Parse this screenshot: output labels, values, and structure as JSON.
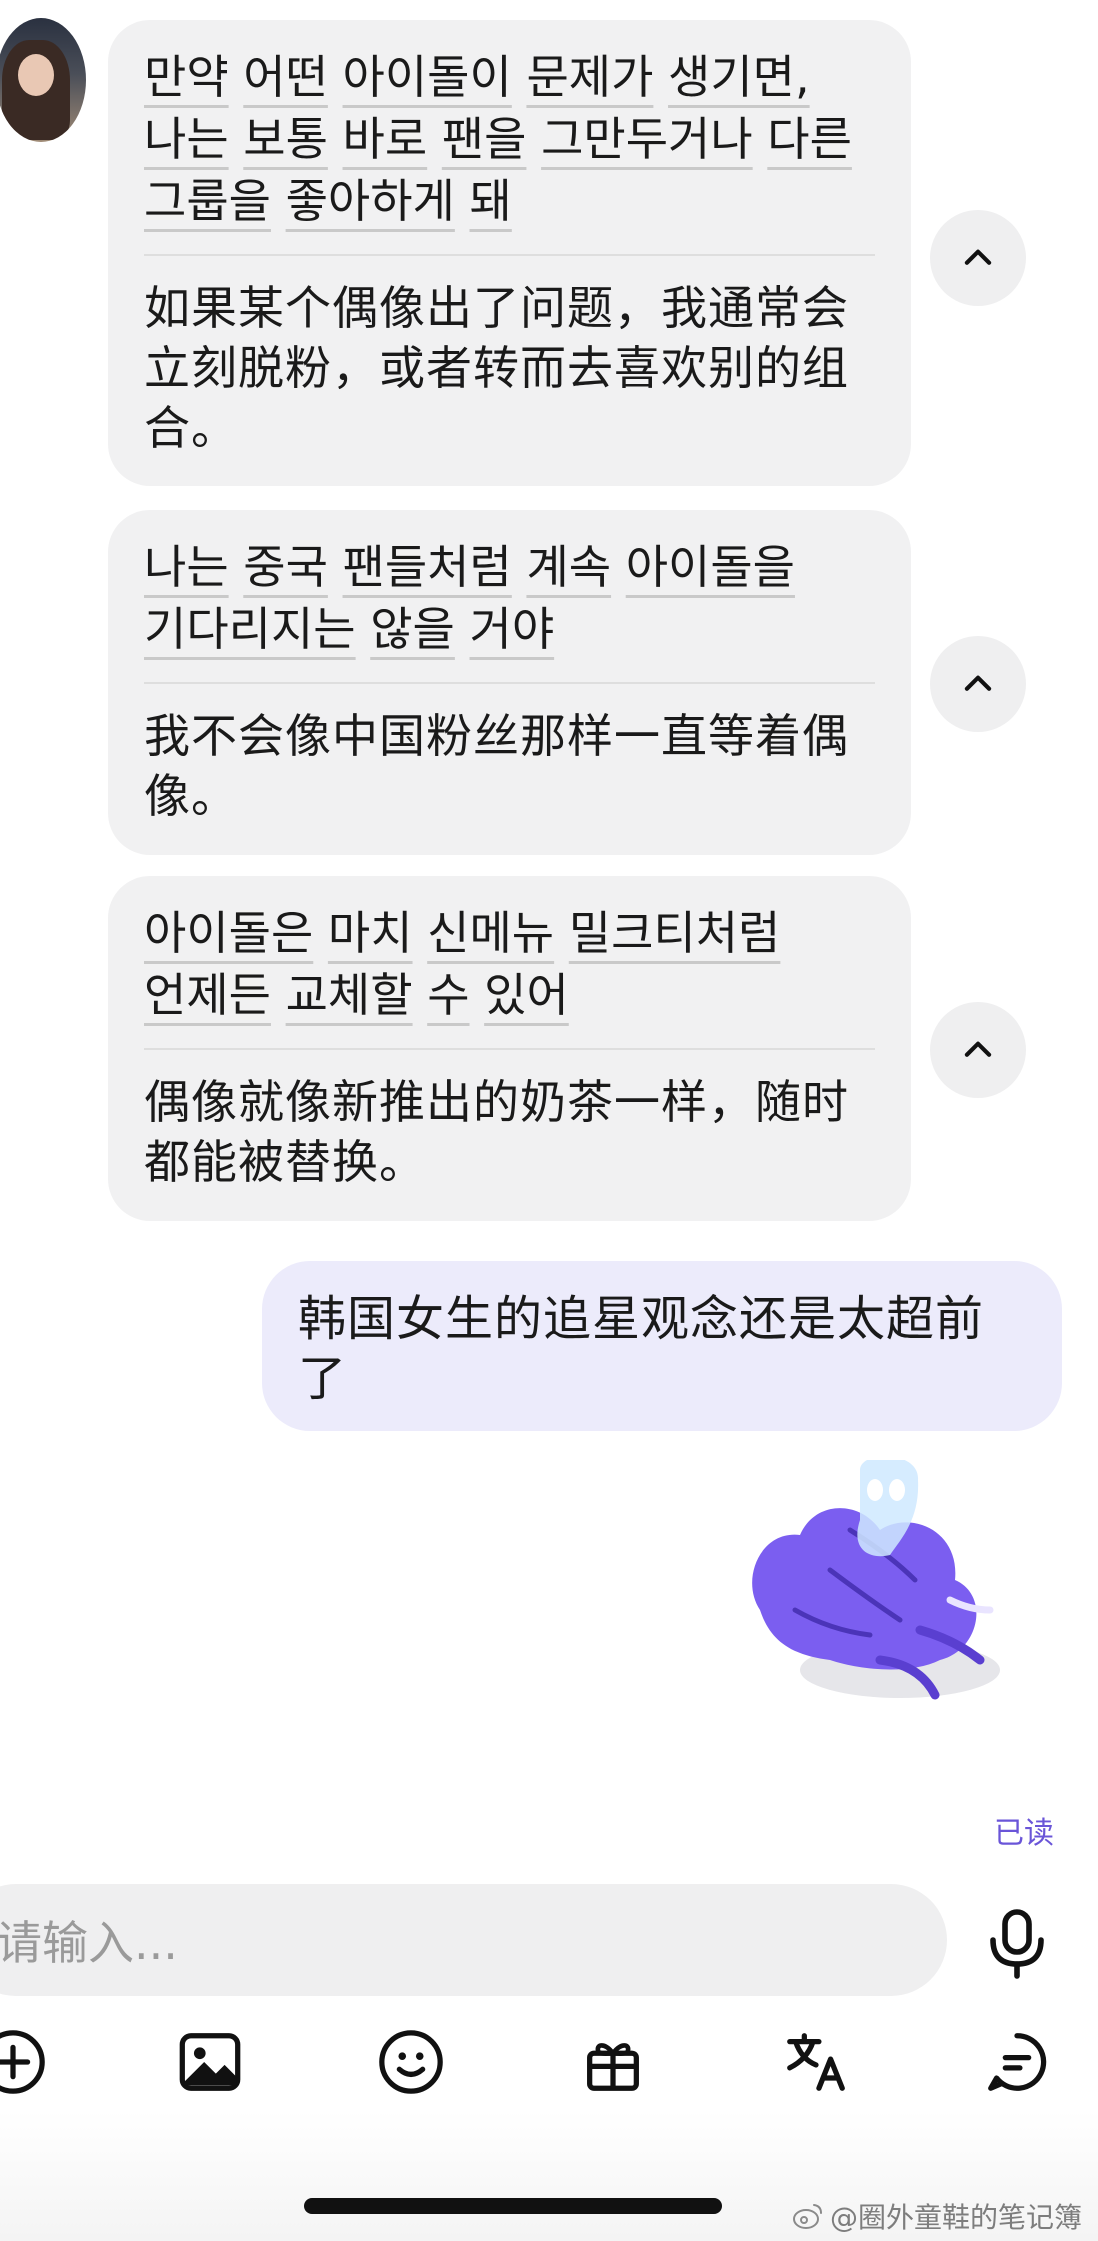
{
  "messages": [
    {
      "korean_words": [
        "만약",
        "어떤",
        "아이돌이",
        "문제가",
        "생기면,",
        "나는",
        "보통",
        "바로",
        "팬을",
        "그만두거나",
        "다른",
        "그룹을",
        "좋아하게",
        "돼"
      ],
      "chinese": "如果某个偶像出了问题，我通常会立刻脱粉，或者转而去喜欢别的组合。"
    },
    {
      "korean_words": [
        "나는",
        "중국",
        "팬들처럼",
        "계속",
        "아이돌을",
        "기다리지는",
        "않을",
        "거야"
      ],
      "chinese": "我不会像中国粉丝那样一直等着偶像。"
    },
    {
      "korean_words": [
        "아이돌은",
        "마치",
        "신메뉴",
        "밀크티처럼",
        "언제든",
        "교체할",
        "수",
        "있어"
      ],
      "chinese": "偶像就像新推出的奶茶一样，随时都能被替换。"
    }
  ],
  "my_message": "韩国女生的追星观念还是太超前了",
  "read_status": "已读",
  "input": {
    "placeholder": "请输入..."
  },
  "toolbar": [
    "plus-icon",
    "image-icon",
    "emoji-icon",
    "gift-icon",
    "translate-icon",
    "chat-icon"
  ],
  "watermark": "@圈外童鞋的笔记簿",
  "colors": {
    "bubble_bg": "#f1f1f2",
    "my_bubble_bg": "#ecebfb",
    "accent": "#6a55d8"
  }
}
